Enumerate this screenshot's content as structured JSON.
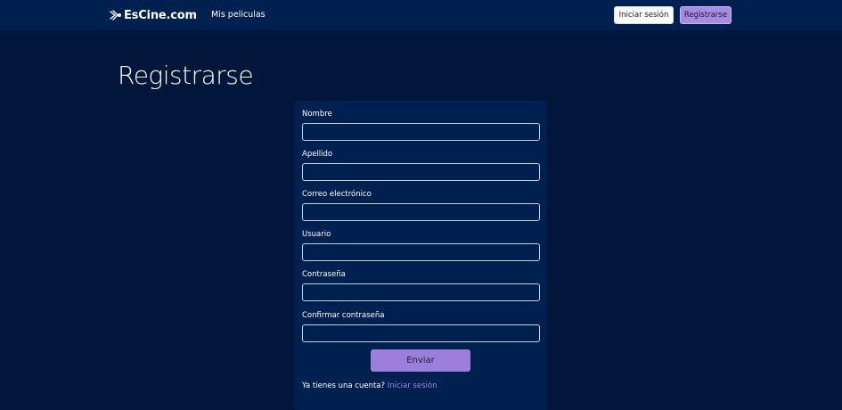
{
  "navbar": {
    "brand_text": "EsCine.com",
    "brand_icon": "film-reel-logo",
    "links": [
      {
        "label": "Mis peliculas"
      }
    ],
    "login_label": "Iniciar sesión",
    "register_label": "Registrarse"
  },
  "page": {
    "title": "Registrarse"
  },
  "form": {
    "fields": [
      {
        "label": "Nombre",
        "value": ""
      },
      {
        "label": "Apellido",
        "value": ""
      },
      {
        "label": "Correo electrónico",
        "value": ""
      },
      {
        "label": "Usuario",
        "value": ""
      },
      {
        "label": "Contraseña",
        "value": ""
      },
      {
        "label": "Confirmar contraseña",
        "value": ""
      }
    ],
    "submit_label": "Enviar",
    "footer_text": "Ya tienes una cuenta?",
    "footer_link": "Iniciar sesión"
  },
  "colors": {
    "page_background": "#01163a",
    "navbar_background": "#00204f",
    "card_background": "#00204f",
    "accent": "#9d7fdb",
    "link": "#9f88e6"
  }
}
